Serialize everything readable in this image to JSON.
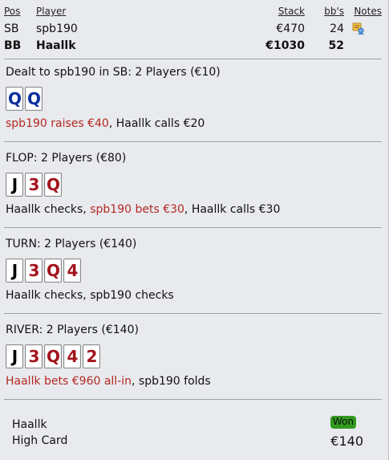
{
  "players_table": {
    "headers": {
      "pos": "Pos",
      "player": "Player",
      "stack": "Stack",
      "bb": "bb's",
      "notes": "Notes"
    },
    "rows": [
      {
        "pos": "SB",
        "player": "spb190",
        "stack": "€470",
        "bb": "24",
        "has_note": true
      },
      {
        "pos": "BB",
        "player": "Haallk",
        "stack": "€1030",
        "bb": "52",
        "has_note": false
      }
    ]
  },
  "preflop": {
    "title": "Dealt to spb190 in SB: 2 Players (€10)",
    "cards": [
      "Q",
      "Q"
    ],
    "action_parts": [
      {
        "text": "spb190 raises €40",
        "highlight": true
      },
      {
        "text": ", Haallk calls €20",
        "highlight": false
      }
    ]
  },
  "flop": {
    "title": "FLOP: 2 Players (€80)",
    "cards": [
      "J",
      "3",
      "Q"
    ],
    "action_parts": [
      {
        "text": "Haallk checks, ",
        "highlight": false
      },
      {
        "text": "spb190 bets €30",
        "highlight": true
      },
      {
        "text": ", Haallk calls €30",
        "highlight": false
      }
    ]
  },
  "turn": {
    "title": "TURN: 2 Players (€140)",
    "cards": [
      "J",
      "3",
      "Q",
      "4"
    ],
    "action_parts": [
      {
        "text": "Haallk checks, spb190 checks",
        "highlight": false
      }
    ]
  },
  "river": {
    "title": "RIVER: 2 Players (€140)",
    "cards": [
      "J",
      "3",
      "Q",
      "4",
      "2"
    ],
    "action_parts": [
      {
        "text": "Haallk bets €960 all-in",
        "highlight": true
      },
      {
        "text": ", spb190 folds",
        "highlight": false
      }
    ]
  },
  "result": {
    "winner": "Haallk",
    "hand": "High Card",
    "badge": "Won",
    "amount": "€140"
  },
  "colors": {
    "background": "#e8eaee",
    "highlight_text": "#b42a22",
    "won_badge": "#2f9a1d",
    "card_blue": "#0b2f9e",
    "card_red": "#a3141d",
    "card_black": "#000000"
  }
}
